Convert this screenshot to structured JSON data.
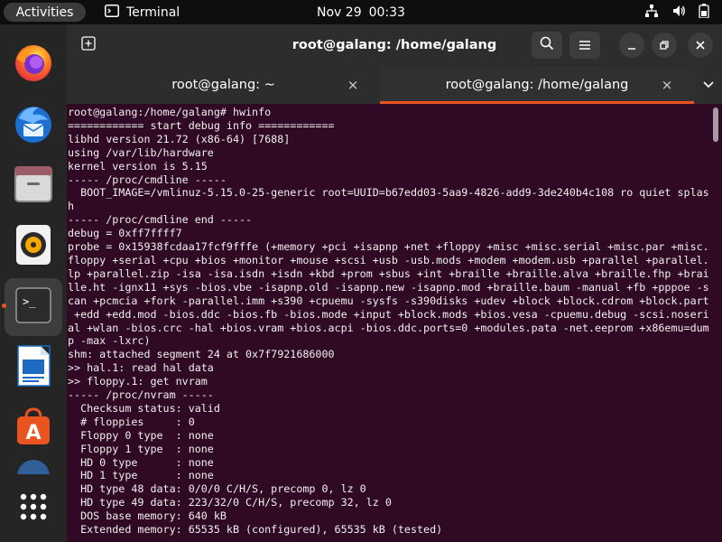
{
  "topbar": {
    "activities": "Activities",
    "app_name": "Terminal",
    "date": "Nov 29",
    "time": "00:33",
    "icons": [
      "network-icon",
      "volume-icon",
      "battery-icon"
    ]
  },
  "dock": {
    "items": [
      {
        "name": "firefox",
        "icon": "firefox-icon"
      },
      {
        "name": "thunderbird",
        "icon": "thunderbird-icon"
      },
      {
        "name": "files",
        "icon": "files-icon"
      },
      {
        "name": "rhythmbox",
        "icon": "rhythmbox-icon"
      },
      {
        "name": "terminal",
        "icon": "terminal-icon",
        "active": true
      },
      {
        "name": "libreoffice-writer",
        "icon": "writer-icon"
      },
      {
        "name": "ubuntu-software",
        "icon": "software-icon"
      },
      {
        "name": "help",
        "icon": "help-icon"
      },
      {
        "name": "show-apps",
        "icon": "grid-icon"
      }
    ],
    "accent": "#e95420"
  },
  "window": {
    "title": "root@galang: /home/galang",
    "tabs": [
      {
        "label": "root@galang: ~",
        "active": false
      },
      {
        "label": "root@galang: /home/galang",
        "active": true
      }
    ],
    "tab_close": "×"
  },
  "terminal": {
    "background": "#300a24",
    "lines": [
      "root@galang:/home/galang# hwinfo",
      "============ start debug info ============",
      "libhd version 21.72 (x86-64) [7688]",
      "using /var/lib/hardware",
      "kernel version is 5.15",
      "----- /proc/cmdline -----",
      "  BOOT_IMAGE=/vmlinuz-5.15.0-25-generic root=UUID=b67edd03-5aa9-4826-add9-3de240b4c108 ro quiet splas",
      "h",
      "----- /proc/cmdline end -----",
      "debug = 0xff7ffff7",
      "probe = 0x15938fcdaa17fcf9fffe (+memory +pci +isapnp +net +floppy +misc +misc.serial +misc.par +misc.",
      "floppy +serial +cpu +bios +monitor +mouse +scsi +usb -usb.mods +modem +modem.usb +parallel +parallel.",
      "lp +parallel.zip -isa -isa.isdn +isdn +kbd +prom +sbus +int +braille +braille.alva +braille.fhp +brai",
      "lle.ht -ignx11 +sys -bios.vbe -isapnp.old -isapnp.new -isapnp.mod +braille.baum -manual +fb +pppoe -s",
      "can +pcmcia +fork -parallel.imm +s390 +cpuemu -sysfs -s390disks +udev +block +block.cdrom +block.part",
      " +edd +edd.mod -bios.ddc -bios.fb -bios.mode +input +block.mods +bios.vesa -cpuemu.debug -scsi.noseri",
      "al +wlan -bios.crc -hal +bios.vram +bios.acpi -bios.ddc.ports=0 +modules.pata -net.eeprom +x86emu=dum",
      "p -max -lxrc)",
      "shm: attached segment 24 at 0x7f7921686000",
      ">> hal.1: read hal data",
      ">> floppy.1: get nvram",
      "----- /proc/nvram -----",
      "  Checksum status: valid",
      "  # floppies     : 0",
      "  Floppy 0 type  : none",
      "  Floppy 1 type  : none",
      "  HD 0 type      : none",
      "  HD 1 type      : none",
      "  HD type 48 data: 0/0/0 C/H/S, precomp 0, lz 0",
      "  HD type 49 data: 223/32/0 C/H/S, precomp 32, lz 0",
      "  DOS base memory: 640 kB",
      "  Extended memory: 65535 kB (configured), 65535 kB (tested)"
    ]
  }
}
